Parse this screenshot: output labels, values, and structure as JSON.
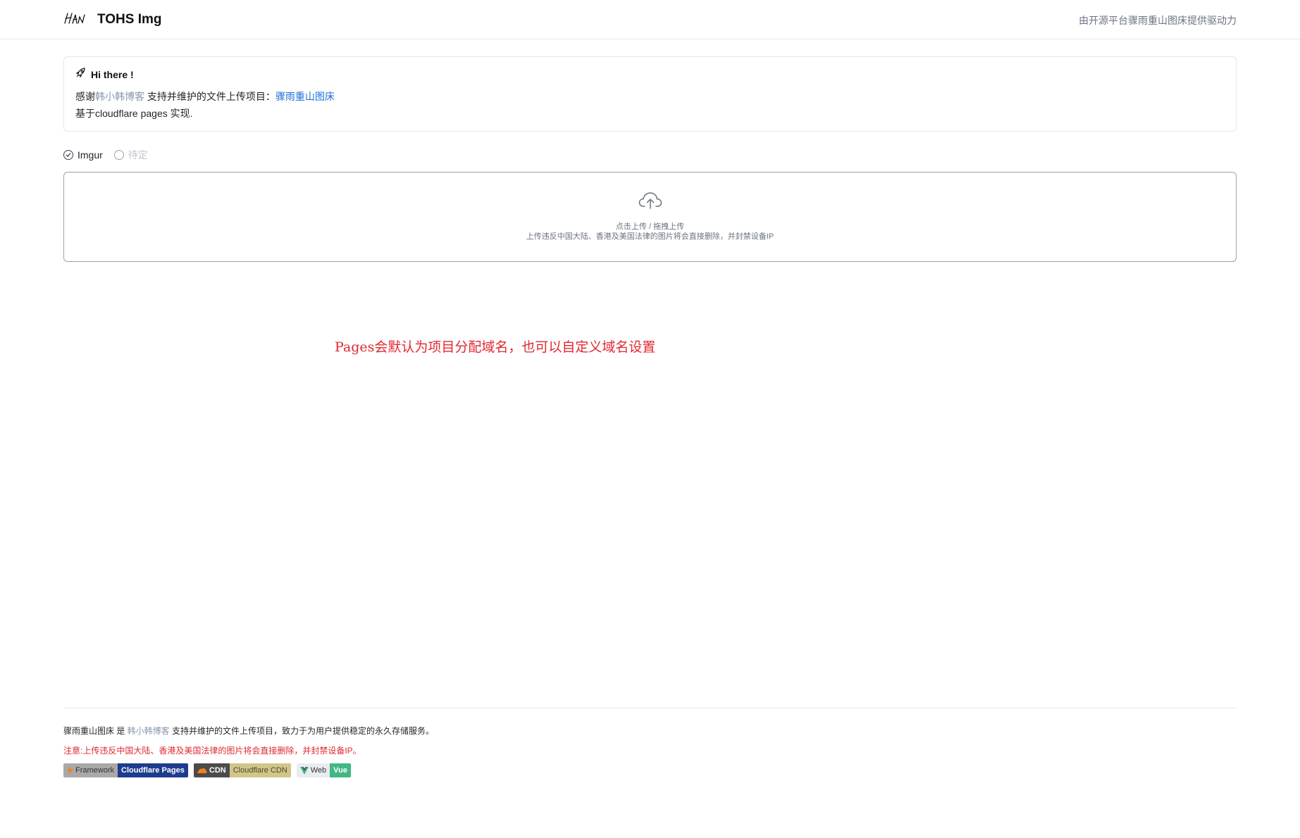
{
  "header": {
    "logo_text": "HAN",
    "title": "TOHS Img",
    "powered_by": "由开源平台骤雨重山图床提供驱动力"
  },
  "card": {
    "heading": "Hi there !",
    "line1_prefix": "感谢",
    "line1_author": "韩小韩博客",
    "line1_middle": " 支持并维护的文件上传项目：",
    "line1_link": "骤雨重山图床",
    "line2": "基于cloudflare pages 实现."
  },
  "radios": [
    {
      "label": "Imgur",
      "checked": true,
      "disabled": false
    },
    {
      "label": "待定",
      "checked": false,
      "disabled": true
    }
  ],
  "upload": {
    "line1": "点击上传 / 拖拽上传",
    "line2": "上传违反中国大陆、香港及美国法律的图片将会直接删除，并封禁设备IP"
  },
  "annotation": "Pages会默认为项目分配域名，也可以自定义域名设置",
  "footer": {
    "p1_prefix": "骤雨重山图床 是 ",
    "p1_author": "韩小韩博客",
    "p1_suffix": " 支持并维护的文件上传项目，致力于为用户提供稳定的永久存储服务。",
    "p2": "注意:上传违反中国大陆、香港及美国法律的图片将会直接删除，并封禁设备IP。",
    "badges": [
      {
        "left": "Framework",
        "right": "Cloudflare Pages",
        "icon": "lightning-icon"
      },
      {
        "left": "CDN",
        "right": "Cloudflare CDN",
        "icon": "cloud-icon"
      },
      {
        "left": "Web",
        "right": "Vue",
        "icon": "vue-icon"
      }
    ]
  },
  "colors": {
    "link_blue": "#1d6fd8",
    "muted_link": "#8a98ad",
    "warning_red": "#e0282e"
  }
}
